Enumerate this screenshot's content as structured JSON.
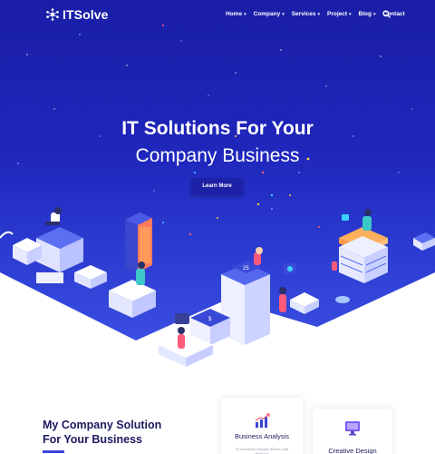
{
  "brand": {
    "name": "ITSolve"
  },
  "nav": {
    "items": [
      {
        "label": "Home",
        "has_dropdown": true
      },
      {
        "label": "Company",
        "has_dropdown": true
      },
      {
        "label": "Services",
        "has_dropdown": true
      },
      {
        "label": "Project",
        "has_dropdown": true
      },
      {
        "label": "Blog",
        "has_dropdown": true
      },
      {
        "label": "Contact",
        "has_dropdown": false
      }
    ],
    "search_icon": "search-icon"
  },
  "hero": {
    "title_line1": "IT Solutions For Your",
    "title_line2": "Company Business",
    "cta_label": "Learn More"
  },
  "about": {
    "title_line1": "My Company Solution",
    "title_line2": "For Your Business"
  },
  "services": [
    {
      "title": "Business Analysis",
      "icon": "chart-icon",
      "snippet": "To economic insights deliver sold financial"
    },
    {
      "title": "Creative Design",
      "icon": "monitor-design-icon"
    }
  ],
  "colors": {
    "hero_top": "#1b1fa8",
    "hero_bottom": "#3346d6",
    "accent": "#3b44d8",
    "button": "#1c21a6",
    "heading": "#1a1a5e"
  }
}
